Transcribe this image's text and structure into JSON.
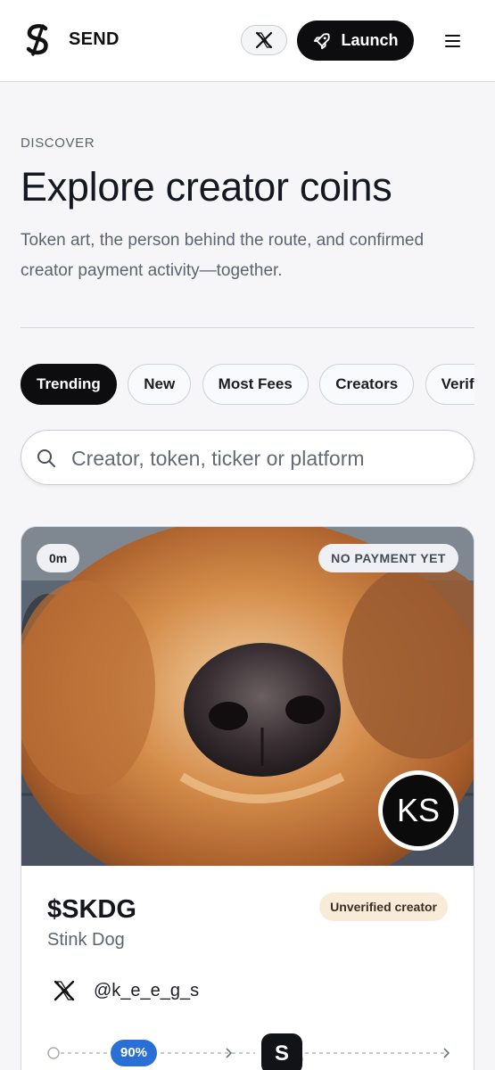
{
  "header": {
    "brand": "SEND",
    "launch_label": "Launch"
  },
  "hero": {
    "eyebrow": "DISCOVER",
    "title": "Explore creator coins",
    "subtitle": "Token art, the person behind the route, and confirmed creator payment activity—together."
  },
  "filters": {
    "active": "Trending",
    "items": [
      "Trending",
      "New",
      "Most Fees",
      "Creators",
      "Verified"
    ]
  },
  "search": {
    "placeholder": "Creator, token, ticker or platform",
    "value": ""
  },
  "cards": [
    {
      "age": "0m",
      "payment_status": "NO PAYMENT YET",
      "avatar_initials": "KS",
      "ticker": "$SKDG",
      "name": "Stink Dog",
      "verification": "Unverified creator",
      "social_platform": "x-icon",
      "handle": "@k_e_e_g_s",
      "progress_label": "90%",
      "progress_value": 0.9,
      "node_label": "S"
    }
  ],
  "colors": {
    "primary": "#0d0d0f",
    "progress_badge": "#2a6fd6",
    "unverified_badge": "#f8ecd9",
    "page_bg": "#f6f6f8"
  }
}
